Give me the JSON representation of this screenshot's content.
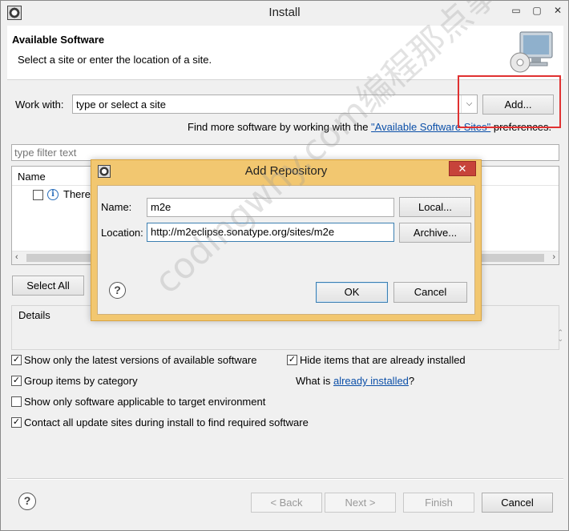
{
  "window": {
    "title": "Install",
    "controls": {
      "minimize": "▭",
      "maximize": "▢",
      "close": "✕"
    }
  },
  "header": {
    "title": "Available Software",
    "subtitle": "Select a site or enter the location of a site."
  },
  "work_with": {
    "label": "Work with:",
    "value": "type or select a site",
    "add_button": "Add...",
    "more_prefix": "Find more software by working with the ",
    "more_link": "\"Available Software Sites\"",
    "more_suffix": " preferences."
  },
  "filter": {
    "placeholder": "type filter text"
  },
  "tree": {
    "column_name": "Name",
    "row_text": "There"
  },
  "select_all_button": "Select All",
  "details": {
    "label": "Details"
  },
  "options": [
    {
      "label": "Show only the latest versions of available software",
      "checked": true
    },
    {
      "label": "Group items by category",
      "checked": true
    },
    {
      "label": "Show only software applicable to target environment",
      "checked": false
    },
    {
      "label": "Contact all update sites during install to find required software",
      "checked": true
    }
  ],
  "options_right": {
    "hide_installed": {
      "label": "Hide items that are already installed",
      "checked": true
    },
    "what_is_prefix": "What is ",
    "what_is_link": "already installed",
    "what_is_suffix": "?"
  },
  "footer": {
    "back": "< Back",
    "next": "Next >",
    "finish": "Finish",
    "cancel": "Cancel"
  },
  "dialog": {
    "title": "Add Repository",
    "name_label": "Name:",
    "name_value": "m2e",
    "location_label": "Location:",
    "location_value": "http://m2eclipse.sonatype.org/sites/m2e",
    "local_button": "Local...",
    "archive_button": "Archive...",
    "ok_button": "OK",
    "cancel_button": "Cancel",
    "close": "✕"
  },
  "watermark": "codingwhy.com编程那点事"
}
